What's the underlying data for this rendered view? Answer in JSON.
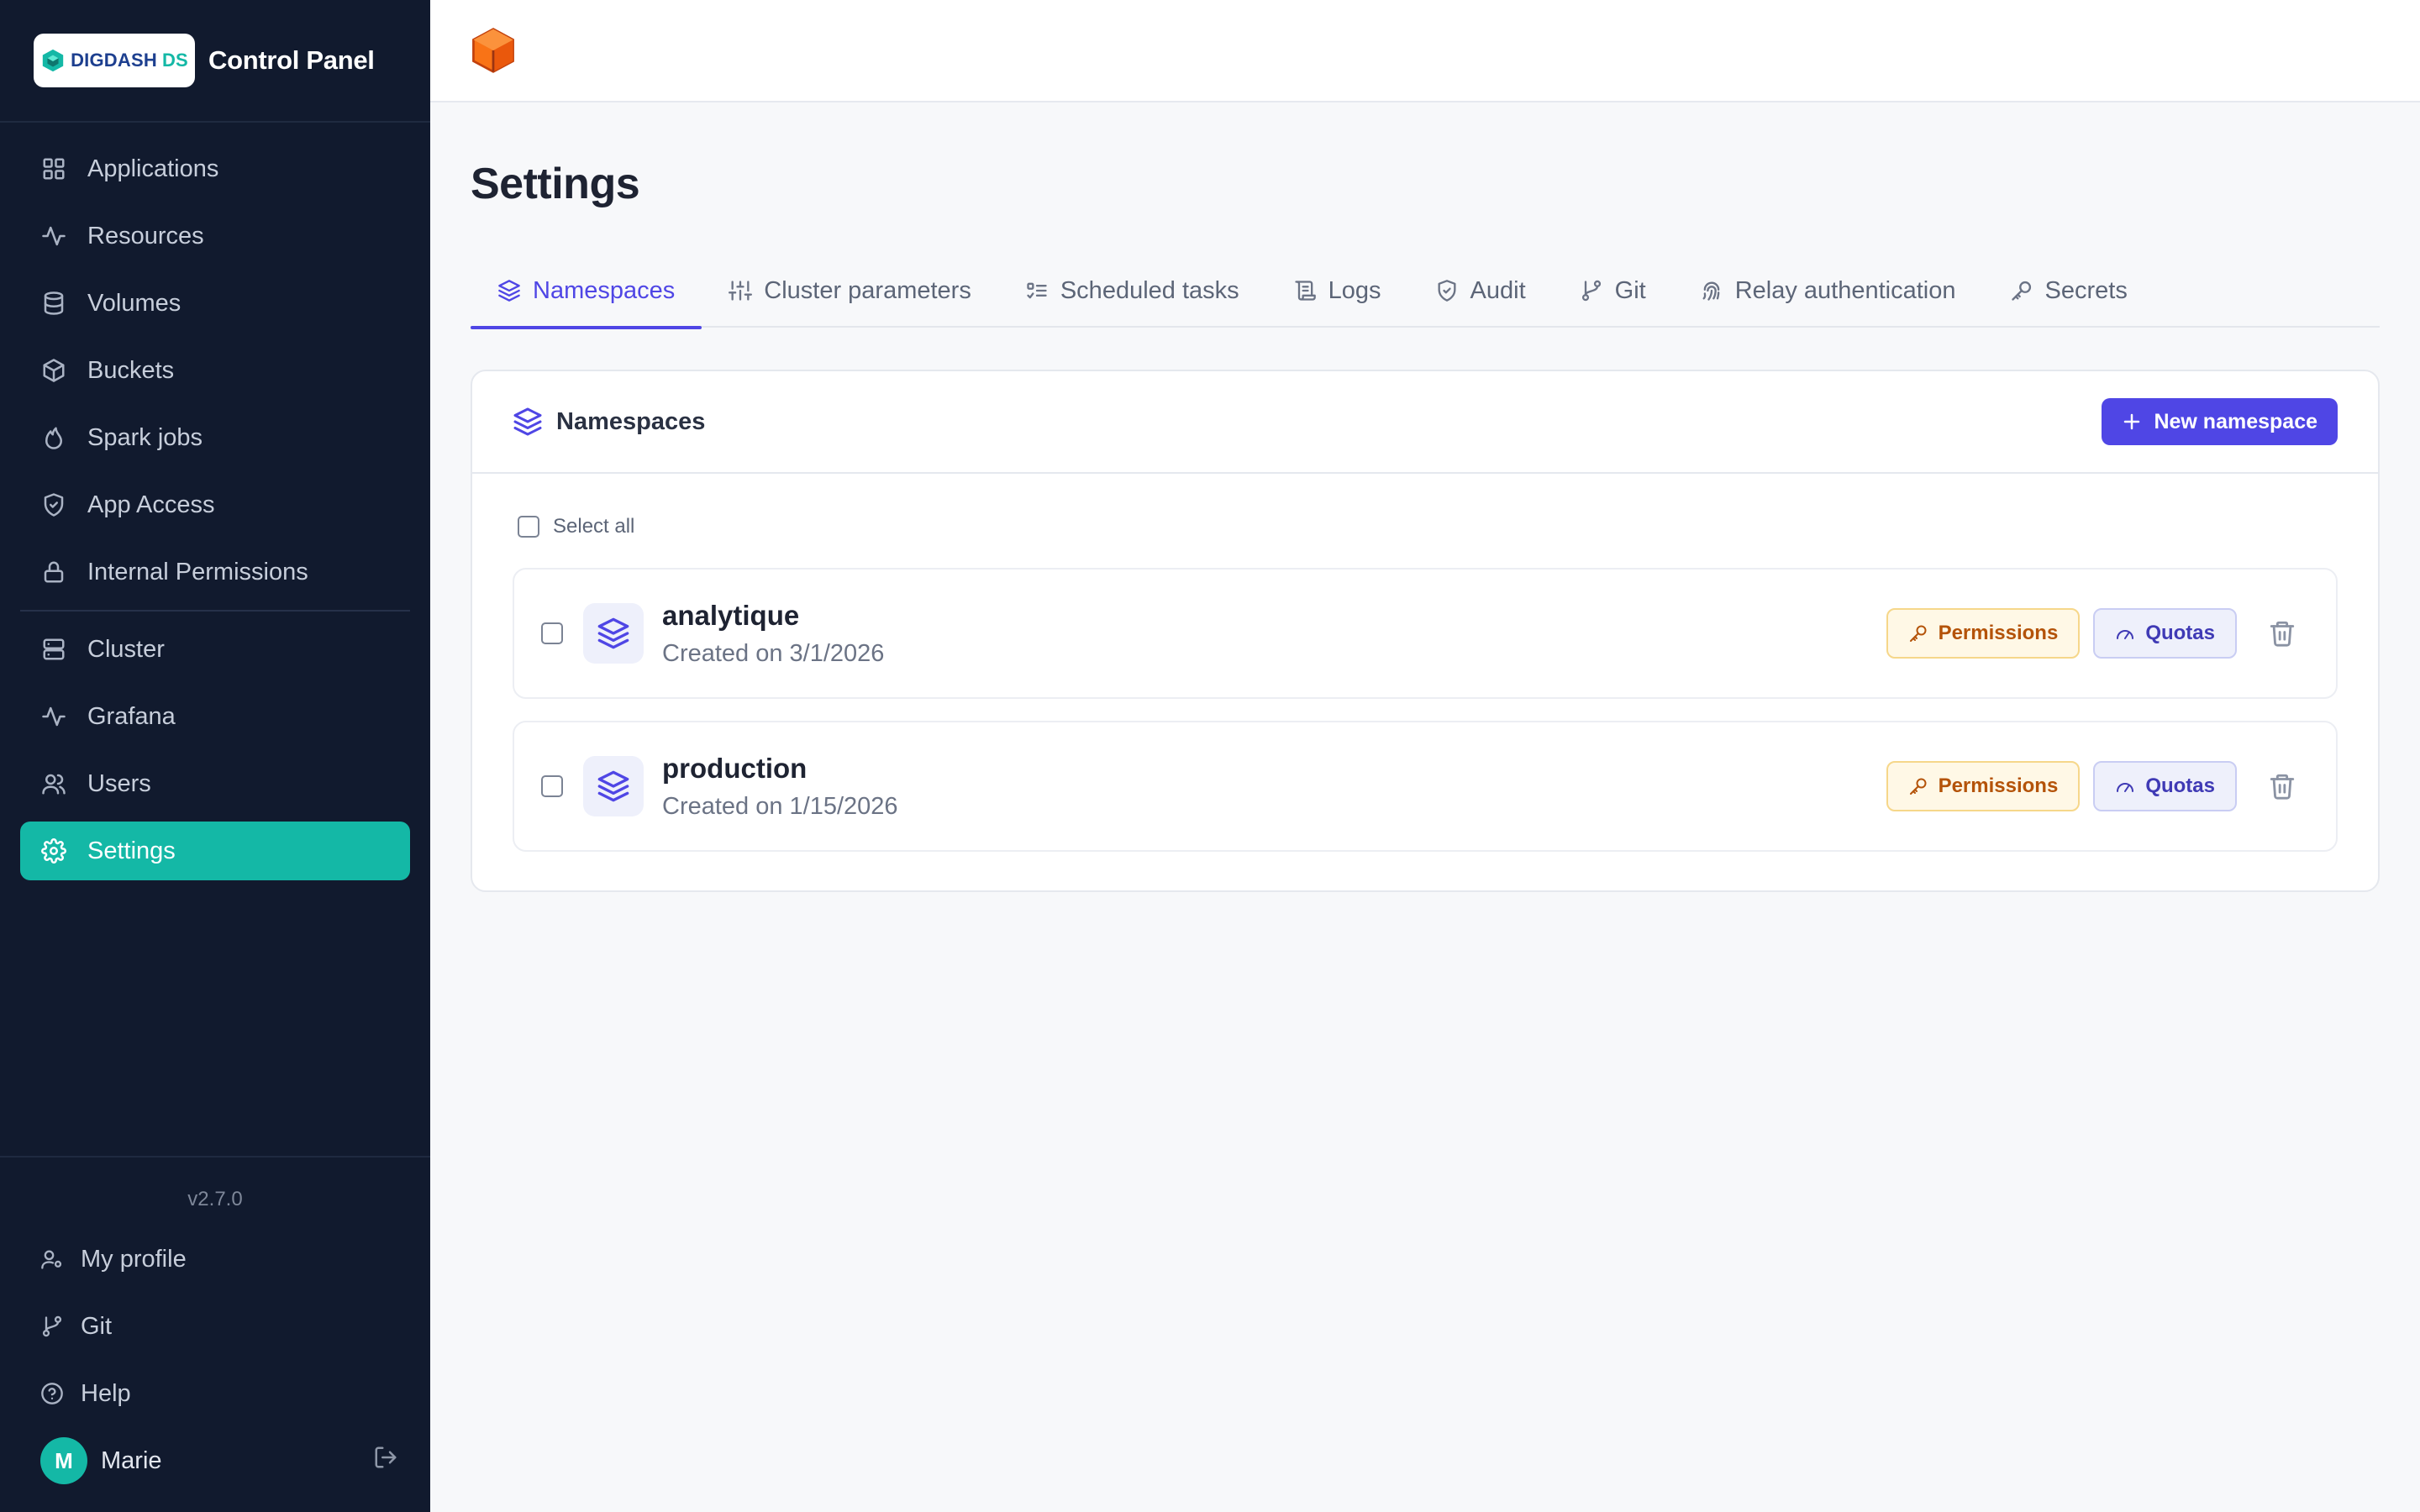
{
  "brand": {
    "logo_main": "DIGDASH",
    "logo_suffix": "DS",
    "app_title": "Control Panel"
  },
  "sidebar": {
    "items": [
      {
        "label": "Applications",
        "icon": "grid-icon"
      },
      {
        "label": "Resources",
        "icon": "activity-icon"
      },
      {
        "label": "Volumes",
        "icon": "database-icon"
      },
      {
        "label": "Buckets",
        "icon": "box-icon"
      },
      {
        "label": "Spark jobs",
        "icon": "flame-icon"
      },
      {
        "label": "App Access",
        "icon": "shield-check-icon"
      },
      {
        "label": "Internal Permissions",
        "icon": "lock-icon"
      },
      {
        "label": "Cluster",
        "icon": "server-icon"
      },
      {
        "label": "Grafana",
        "icon": "activity-icon"
      },
      {
        "label": "Users",
        "icon": "users-icon"
      },
      {
        "label": "Settings",
        "icon": "gear-icon",
        "active": true
      }
    ],
    "version": "v2.7.0",
    "footer": [
      {
        "label": "My profile",
        "icon": "user-cog-icon"
      },
      {
        "label": "Git",
        "icon": "git-branch-icon"
      },
      {
        "label": "Help",
        "icon": "help-circle-icon"
      }
    ],
    "user": {
      "initial": "M",
      "name": "Marie"
    }
  },
  "page": {
    "title": "Settings"
  },
  "tabs": [
    {
      "label": "Namespaces",
      "icon": "layers-icon",
      "active": true
    },
    {
      "label": "Cluster parameters",
      "icon": "sliders-icon"
    },
    {
      "label": "Scheduled tasks",
      "icon": "list-check-icon"
    },
    {
      "label": "Logs",
      "icon": "scroll-icon"
    },
    {
      "label": "Audit",
      "icon": "shield-check-icon"
    },
    {
      "label": "Git",
      "icon": "git-branch-icon"
    },
    {
      "label": "Relay authentication",
      "icon": "fingerprint-icon"
    },
    {
      "label": "Secrets",
      "icon": "key-icon"
    }
  ],
  "namespaces_card": {
    "title": "Namespaces",
    "new_button": "New namespace",
    "select_all": "Select all",
    "rows": [
      {
        "name": "analytique",
        "created": "Created on 3/1/2026",
        "permissions_label": "Permissions",
        "quotas_label": "Quotas"
      },
      {
        "name": "production",
        "created": "Created on 1/15/2026",
        "permissions_label": "Permissions",
        "quotas_label": "Quotas"
      }
    ]
  },
  "colors": {
    "sidebar_bg": "#111a2e",
    "accent_teal": "#14b8a6",
    "accent_indigo": "#4f46e5",
    "permissions_amber": "#b45309"
  }
}
